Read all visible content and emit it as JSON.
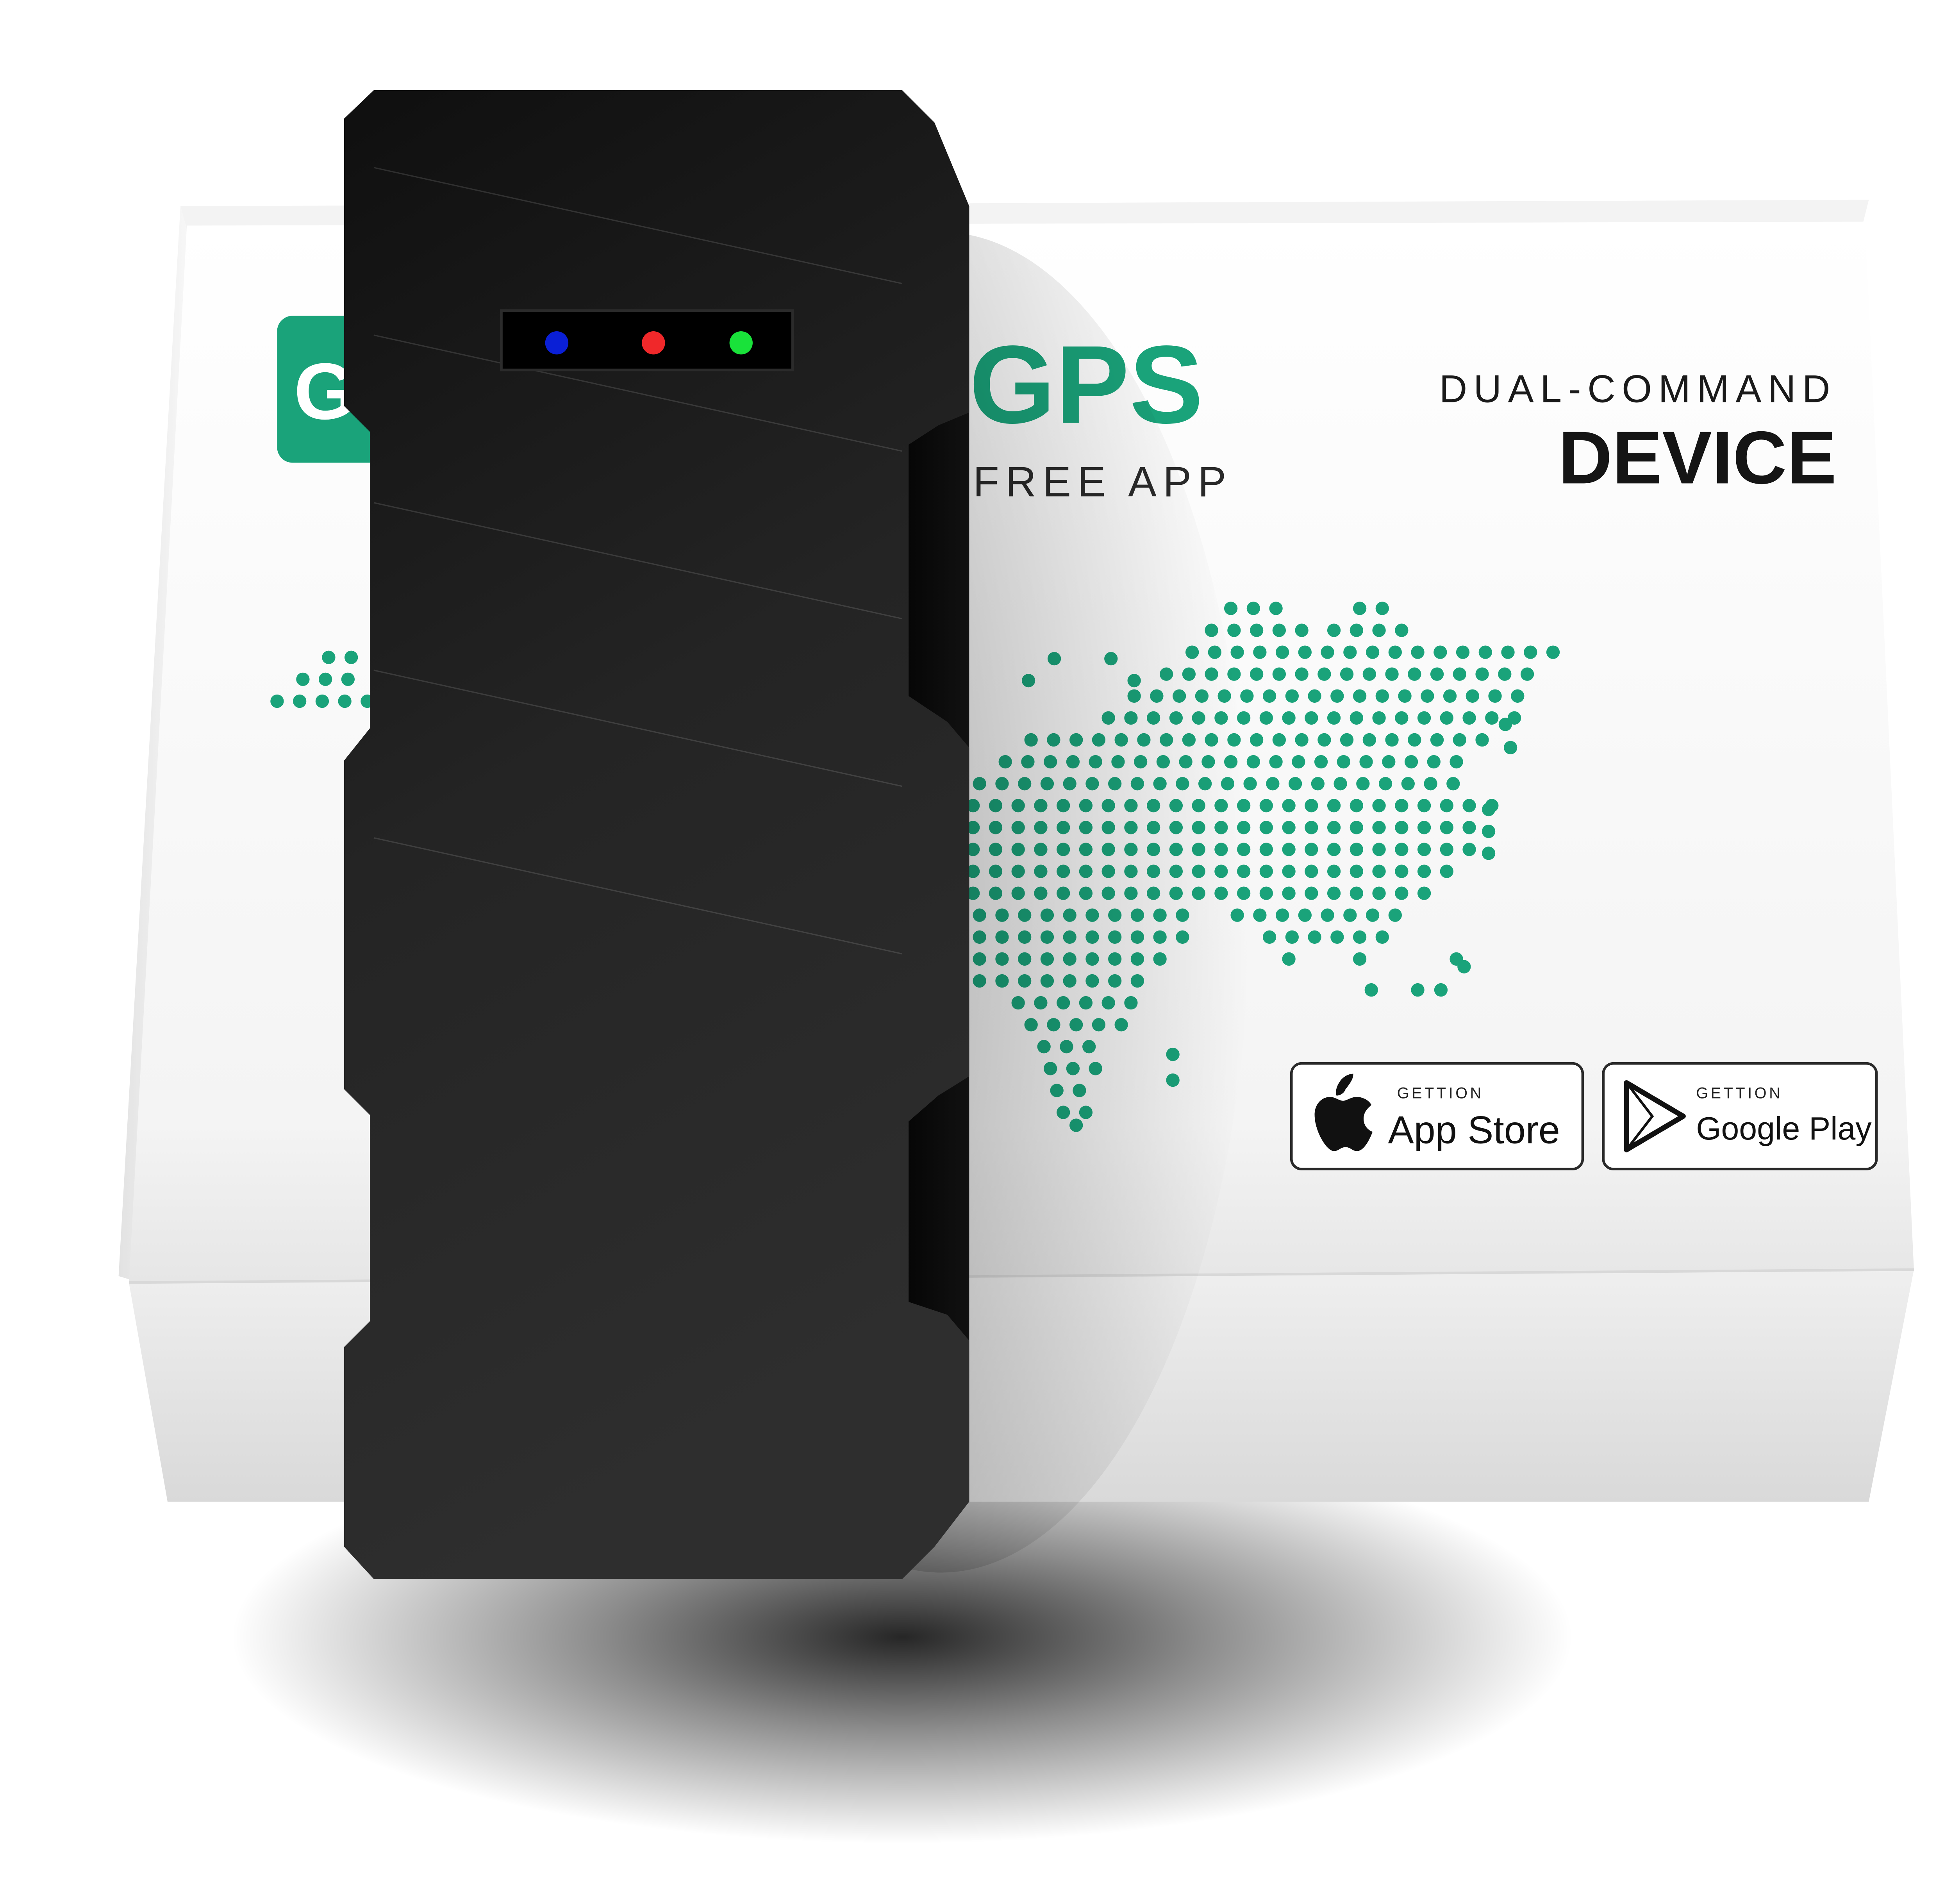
{
  "box": {
    "logo_partial": "G",
    "brand_suffix": "GPS",
    "tagline": "FREE APP",
    "headline_small": "DUAL-COMMAND",
    "headline_large": "DEVICE",
    "accent_color": "#1aa37a"
  },
  "badges": {
    "app_store": {
      "small": "GETTION",
      "large": "App Store",
      "icon": "apple-icon"
    },
    "google_play": {
      "small": "GETTION",
      "large": "Google Play",
      "icon": "play-icon"
    }
  },
  "device": {
    "color": "#1c1c1c",
    "leds": [
      {
        "name": "blue",
        "color": "#0a1fd6"
      },
      {
        "name": "red",
        "color": "#f0282a"
      },
      {
        "name": "green",
        "color": "#19e23a"
      }
    ]
  }
}
